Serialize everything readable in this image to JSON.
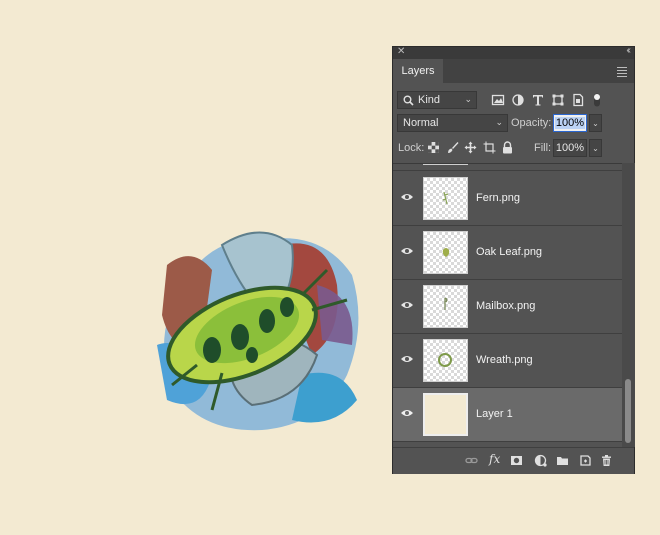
{
  "panel": {
    "tab_label": "Layers",
    "filter": {
      "kind_label": "Kind",
      "icons": [
        "image-filter-icon",
        "adjustment-filter-icon",
        "type-filter-icon",
        "shape-filter-icon",
        "smart-object-filter-icon",
        "filter-toggle-icon"
      ]
    },
    "blend_mode": "Normal",
    "opacity_label": "Opacity:",
    "opacity_value": "100%",
    "lock_label": "Lock:",
    "lock_icons": [
      "lock-transparent-pixels-icon",
      "lock-image-pixels-icon",
      "lock-position-icon",
      "lock-artboard-icon",
      "lock-all-icon"
    ],
    "fill_label": "Fill:",
    "fill_value": "100%",
    "layers": [
      {
        "name": "Fern.png",
        "visible": true,
        "selected": false
      },
      {
        "name": "Oak Leaf.png",
        "visible": true,
        "selected": false
      },
      {
        "name": "Mailbox.png",
        "visible": true,
        "selected": false
      },
      {
        "name": "Wreath.png",
        "visible": true,
        "selected": false
      },
      {
        "name": "Layer 1",
        "visible": true,
        "selected": true
      }
    ],
    "bottom_icons": [
      "link-layers-icon",
      "fx-icon",
      "add-mask-icon",
      "adjustment-layer-icon",
      "new-group-icon",
      "new-layer-icon",
      "delete-layer-icon"
    ],
    "bottom_labels": {
      "fx": "fx"
    }
  },
  "colors": {
    "canvas": "#f3ead2",
    "panel": "#535353",
    "selected_row": "#6a6a6a",
    "focus": "#2a66d0"
  }
}
